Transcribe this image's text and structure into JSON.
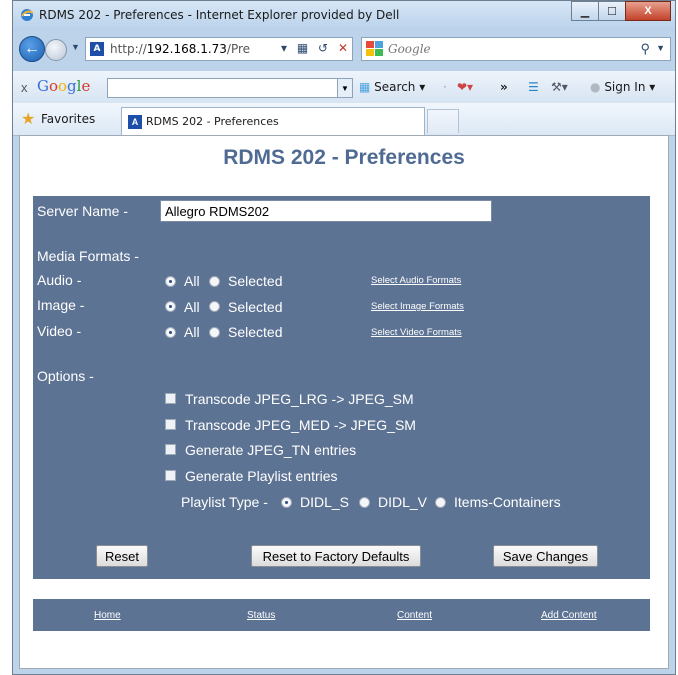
{
  "window": {
    "title": "RDMS 202 - Preferences - Internet Explorer provided by Dell",
    "buttons": {
      "minimize": "▁",
      "maximize": "☐",
      "close": "X"
    }
  },
  "navbar": {
    "address_prefix": "http://",
    "address_host": "192.168.1.73",
    "address_suffix": "/Pre",
    "search_placeholder": "Google"
  },
  "toolbar": {
    "close_label": "x",
    "google_logo": "Google",
    "search_label": "Search",
    "more_label": "»",
    "signin_label": "Sign In"
  },
  "favorites": {
    "label": "Favorites",
    "tab_label": "RDMS 202 - Preferences"
  },
  "page": {
    "title": "RDMS 202 - Preferences",
    "server_name_label": "Server Name -",
    "server_name_value": "Allegro RDMS202",
    "media_formats_label": "Media Formats -",
    "rows": [
      {
        "label": "Audio -",
        "all": "All",
        "selected": "Selected",
        "link": "Select Audio Formats"
      },
      {
        "label": "Image -",
        "all": "All",
        "selected": "Selected",
        "link": "Select Image Formats"
      },
      {
        "label": "Video -",
        "all": "All",
        "selected": "Selected",
        "link": "Select Video Formats"
      }
    ],
    "options_label": "Options -",
    "options": [
      "Transcode JPEG_LRG -> JPEG_SM",
      "Transcode JPEG_MED -> JPEG_SM",
      "Generate JPEG_TN entries",
      "Generate Playlist entries"
    ],
    "playlist_type_label": "Playlist Type -",
    "playlist_types": [
      "DIDL_S",
      "DIDL_V",
      "Items-Containers"
    ],
    "buttons": {
      "reset": "Reset",
      "factory": "Reset to Factory Defaults",
      "save": "Save Changes"
    },
    "footer_links": [
      "Home",
      "Status",
      "Content",
      "Add Content"
    ]
  }
}
